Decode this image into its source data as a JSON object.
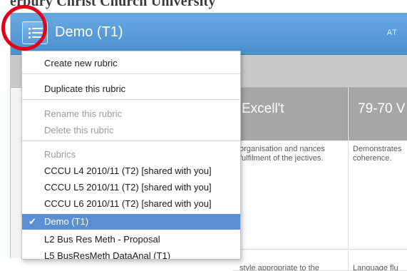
{
  "background": {
    "heading": "erbury Christ Church University"
  },
  "app": {
    "title": "Demo (T1)",
    "title_right": "AT",
    "menu_icon": "list-icon",
    "colors": {
      "titlebar": "#5a9ad8",
      "selected_item": "#5b8fd3",
      "highlight_circle": "#e3001b"
    }
  },
  "menu": {
    "create": "Create new rubric",
    "duplicate": "Duplicate this rubric",
    "rename": "Rename this rubric",
    "delete": "Delete this rubric",
    "rubrics_header": "Rubrics",
    "rubrics": [
      "CCCU L4 2010/11 (T2) [shared with you]",
      "CCCU L5 2010/11 (T2) [shared with you]",
      "CCCU L6 2010/11 (T2) [shared with you]",
      "Demo (T1)",
      "L2 Bus Res Meth - Proposal",
      "L5 BusResMeth DataAnal (T1)"
    ],
    "selected_index": 3,
    "check_icon": "checkmark-icon"
  },
  "grid": {
    "columns": [
      "Excell't",
      "79-70 V"
    ],
    "cells": {
      "r1c1": "organisation and nances fulfilment of the jectives.",
      "r1c2": "Demonstrates coherence.",
      "r2c1": "style appropriate to the",
      "r2c2": "Language flu"
    }
  }
}
